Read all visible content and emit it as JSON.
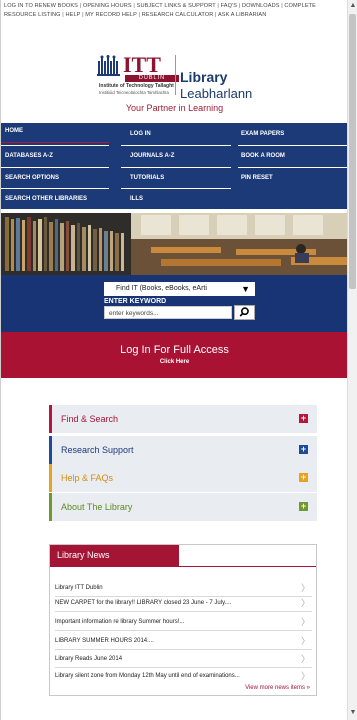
{
  "top_links": [
    {
      "label": "LOG IN TO RENEW BOOKS"
    },
    {
      "label": "OPENING HOURS"
    },
    {
      "label": "SUBJECT LINKS & SUPPORT"
    },
    {
      "label": "FAQ'S"
    },
    {
      "label": "DOWNLOADS"
    },
    {
      "label": "COMPLETE RESOURCE LISTING"
    },
    {
      "label": "HELP"
    },
    {
      "label": "MY RECORD HELP"
    },
    {
      "label": "RESEARCH CALCULATOR"
    },
    {
      "label": "ASK A LIBRARIAN"
    }
  ],
  "logo": {
    "itt": "ITT",
    "dublin": "DUBLIN",
    "institute": "Institute of Technology Tallaght",
    "institute_irish": "Institiúid Teicneolaíochta Tamhlachta",
    "library": "Library",
    "library_irish": "Leabharlann",
    "tagline": "Your Partner in Learning"
  },
  "nav": {
    "home": "HOME",
    "log_in": "LOG IN",
    "exam_papers": "EXAM PAPERS",
    "databases": "DATABASES A-Z",
    "journals": "JOURNALS A-Z",
    "book_room": "BOOK A ROOM",
    "search_options": "SEARCH OPTIONS",
    "tutorials": "TUTORIALS",
    "pin_reset": "PIN RESET",
    "search_other": "SEARCH OTHER LIBRARIES",
    "ills": "ILLS"
  },
  "search": {
    "select_value": "Find IT (Books, eBooks, eArti",
    "keyword_label": "ENTER KEYWORD",
    "keyword_placeholder": "enter keywords..."
  },
  "login_banner": {
    "title": "Log In For Full Access",
    "subtitle": "Click Here"
  },
  "accordion": [
    {
      "label": "Find & Search",
      "color": "#b5163a"
    },
    {
      "label": "Research Support",
      "color": "#1d4a9b"
    },
    {
      "label": "Help & FAQs",
      "color": "#e8a21c"
    },
    {
      "label": "About The Library",
      "color": "#6e9a2c"
    }
  ],
  "news": {
    "heading": "Library News",
    "items": [
      "Library ITT Dublin",
      "NEW CARPET for the library!! LIBRARY closed 23 June - 7 July....",
      "Important information re library Summer hours!...",
      "LIBRARY SUMMER HOURS 2014....",
      "Library Reads June 2014",
      "Library silent zone from Monday 12th May until end of examinations..."
    ],
    "view_more": "View more news items »"
  },
  "colors": {
    "brand_red": "#a91232",
    "brand_navy": "#1c3a78"
  }
}
